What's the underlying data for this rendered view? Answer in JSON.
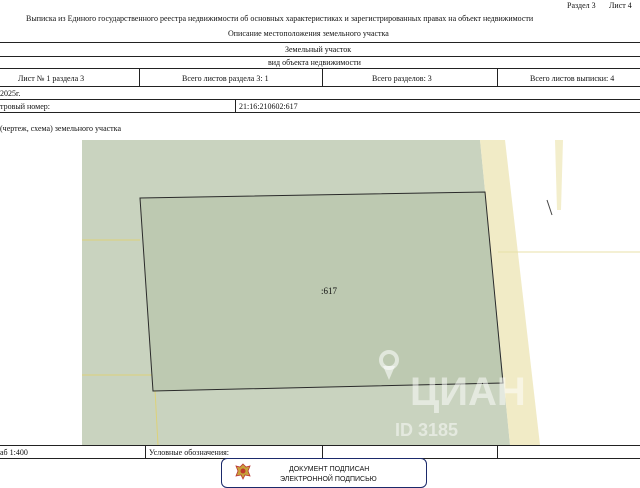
{
  "header": {
    "section_ref": "Раздел 3",
    "sheet_ref": "Лист 4",
    "doc_title": "Выписка из Единого государственного реестра недвижимости об основных характеристиках и зарегистрированных правах на объект недвижимости",
    "section_title": "Описание местоположения земельного участка"
  },
  "object": {
    "type": "Земельный участок",
    "type_caption": "вид объекта недвижимости"
  },
  "sheet_info": {
    "sheet_num": "Лист № 1 раздела 3",
    "sheets_in_section": "Всего листов раздела 3: 1",
    "total_sections": "Всего разделов: 3",
    "total_sheets": "Всего листов выписки: 4"
  },
  "date_row": {
    "date": "2025г."
  },
  "cadastral": {
    "label": "тровый номер:",
    "number": "21:16:210602:617"
  },
  "plan_caption": "(чертеж, схема) земельного участка",
  "map": {
    "parcel_label": ":617",
    "background_color": "#c9d3bf",
    "border_color": "#ede6b8"
  },
  "footer": {
    "scale": "аб 1:400",
    "legend_label": "Условные обозначения:"
  },
  "stamp": {
    "title": "ДОКУМЕНТ ПОДПИСАН",
    "subtitle": "ЭЛЕКТРОННОЙ ПОДПИСЬЮ",
    "border_color": "#1b2a6b"
  },
  "watermark": {
    "brand": "ЦИАН",
    "id_text": "ID 3185"
  }
}
